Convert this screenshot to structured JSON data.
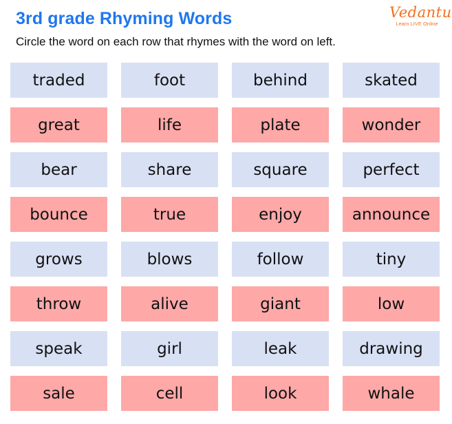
{
  "header": {
    "title": "3rd grade Rhyming Words",
    "instructions": "Circle the word on each row that rhymes with the word on left."
  },
  "logo": {
    "brand": "Vedantu",
    "tagline": "Learn LIVE Online",
    "color": "#f37021"
  },
  "colors": {
    "title": "#1f77ee",
    "row_blue": "#d8e0f4",
    "row_pink": "#fea8a8"
  },
  "rows": [
    {
      "style": "blue",
      "words": [
        "traded",
        "foot",
        "behind",
        "skated"
      ]
    },
    {
      "style": "pink",
      "words": [
        "great",
        "life",
        "plate",
        "wonder"
      ]
    },
    {
      "style": "blue",
      "words": [
        "bear",
        "share",
        "square",
        "perfect"
      ]
    },
    {
      "style": "pink",
      "words": [
        "bounce",
        "true",
        "enjoy",
        "announce"
      ]
    },
    {
      "style": "blue",
      "words": [
        "grows",
        "blows",
        "follow",
        "tiny"
      ]
    },
    {
      "style": "pink",
      "words": [
        "throw",
        "alive",
        "giant",
        "low"
      ]
    },
    {
      "style": "blue",
      "words": [
        "speak",
        "girl",
        "leak",
        "drawing"
      ]
    },
    {
      "style": "pink",
      "words": [
        "sale",
        "cell",
        "look",
        "whale"
      ]
    }
  ]
}
